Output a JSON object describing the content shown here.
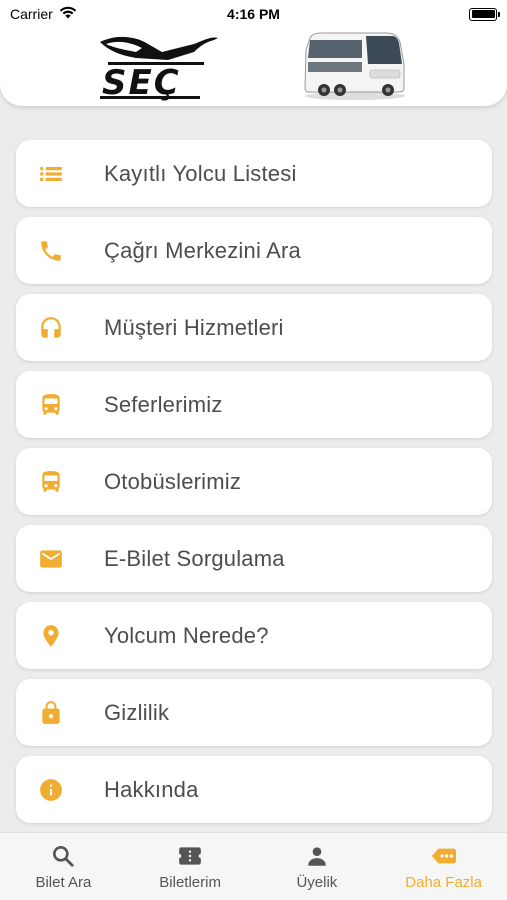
{
  "status_bar": {
    "carrier": "Carrier",
    "time": "4:16 PM"
  },
  "colors": {
    "accent": "#f0ad32",
    "background": "#ececec",
    "card": "#ffffff",
    "text": "#4d4d4d"
  },
  "header": {
    "logo_text": "SEÇ"
  },
  "menu": {
    "items": [
      {
        "label": "Kayıtlı Yolcu Listesi",
        "icon": "list-icon"
      },
      {
        "label": "Çağrı Merkezini Ara",
        "icon": "phone-icon"
      },
      {
        "label": "Müşteri Hizmetleri",
        "icon": "headset-icon"
      },
      {
        "label": "Seferlerimiz",
        "icon": "bus-icon"
      },
      {
        "label": "Otobüslerimiz",
        "icon": "bus-icon"
      },
      {
        "label": "E-Bilet Sorgulama",
        "icon": "mail-icon"
      },
      {
        "label": "Yolcum Nerede?",
        "icon": "location-pin-icon"
      },
      {
        "label": "Gizlilik",
        "icon": "lock-icon"
      },
      {
        "label": "Hakkında",
        "icon": "info-icon"
      }
    ]
  },
  "tab_bar": {
    "tabs": [
      {
        "label": "Bilet Ara",
        "icon": "search-icon",
        "active": false
      },
      {
        "label": "Biletlerim",
        "icon": "ticket-icon",
        "active": false
      },
      {
        "label": "Üyelik",
        "icon": "person-icon",
        "active": false
      },
      {
        "label": "Daha Fazla",
        "icon": "more-tag-icon",
        "active": true
      }
    ]
  }
}
